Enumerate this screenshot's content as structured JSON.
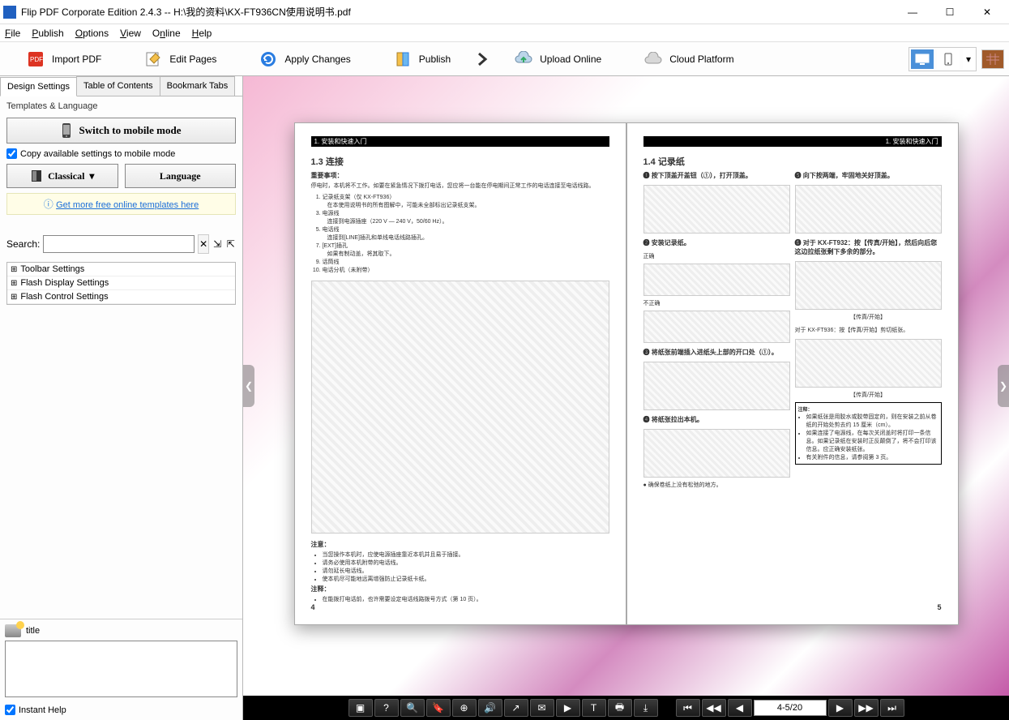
{
  "window": {
    "title": "Flip PDF Corporate Edition 2.4.3  -- H:\\我的资料\\KX-FT936CN使用说明书.pdf"
  },
  "menu": {
    "file": "File",
    "publish": "Publish",
    "options": "Options",
    "view": "View",
    "online": "Online",
    "help": "Help"
  },
  "toolbar": {
    "import": "Import PDF",
    "edit": "Edit Pages",
    "apply": "Apply Changes",
    "publish": "Publish",
    "upload": "Upload Online",
    "cloud": "Cloud Platform"
  },
  "sidebar": {
    "tabs": {
      "design": "Design Settings",
      "toc": "Table of Contents",
      "bookmark": "Bookmark Tabs"
    },
    "templates_label": "Templates & Language",
    "switch_mobile": "Switch to mobile mode",
    "copy_settings": "Copy available settings to mobile mode",
    "classical": "Classical",
    "language": "Language",
    "more_templates": "Get more free online templates here ",
    "search_label": "Search:",
    "tree": [
      "Toolbar Settings",
      "Flash Display Settings",
      "Flash Control Settings"
    ],
    "prop_label": "title",
    "instant_help": "Instant Help"
  },
  "book": {
    "left": {
      "header": "1. 安装和快速入门",
      "title": "1.3 连接",
      "important": "重要事项：",
      "important_line": "停电时，本机将不工作。如要在紧急情况下拨打电话，您应将一台能在停电期间正常工作的电话连接至电话线路。",
      "items": [
        "记录纸支架（仅 KX-FT936）",
        "电源线",
        "电话线",
        "[EXT]插孔",
        "话筒线",
        "电话分机（未附带）"
      ],
      "sub_items": [
        "在本使用说明书的所有图解中，可能未全部标出记录纸支架。",
        "连接到电源插座（220 V — 240 V，50/60 Hz）。",
        "连接到[LINE]插孔和单线电话线路插孔。",
        "如果有制动盖，将其取下。"
      ],
      "caution_title": "注意：",
      "caution": [
        "当您操作本机时，应使电源插座靠近本机并且易于插接。",
        "请务必使用本机附带的电话线。",
        "请勿延长电话线。",
        "使本机尽可能地远离增强防止记录纸卡纸。"
      ],
      "note_title": "注释：",
      "note": "在能拨打电话前，也许需要设定电话线路拨号方式（第 10 页）。",
      "pagenum": "4"
    },
    "right": {
      "header": "1. 安装和快速入门",
      "title": "1.4 记录纸",
      "steps": [
        "按下顶盖开盖钮（①），打开顶盖。",
        "安装记录纸。",
        "将纸张前端插入进纸头上部的开口处（①）。",
        "将纸张拉出本机。",
        "向下按两端，牢固地关好顶盖。",
        "对于 KX-FT932：按【传真/开始】，然后向后您这边拉纸张剩下多余的部分。",
        "对于 KX-FT936：按【传真/开始】剪切纸张。"
      ],
      "labels": {
        "correct": "正确",
        "incorrect": "不正确",
        "fax_start": "【传真/开始】"
      },
      "notebox_title": "注释：",
      "notebox": [
        "如果纸张是用胶水或胶带固定的，则在安装之前从卷纸的开始处剪去约 15 厘米（cm）。",
        "如果连接了电源线，在每次关闭盖时将打印一条信息。如果记录纸在安装时正反颠倒了，将不会打印该信息。应正确安装纸张。",
        "有关附件的信息，请参阅第 3 页。"
      ],
      "confirm": "确保卷纸上没有松弛的地方。",
      "pagenum": "5"
    }
  },
  "bottombar": {
    "page": "4-5/20"
  }
}
